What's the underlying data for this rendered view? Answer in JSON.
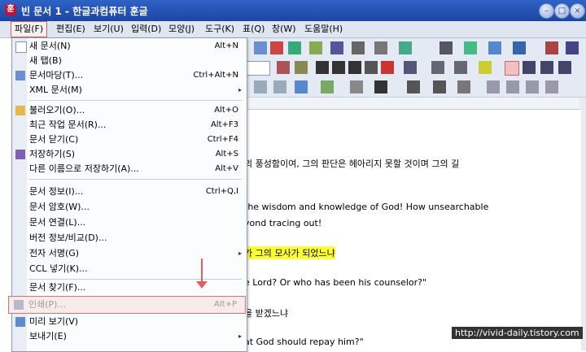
{
  "window": {
    "title": "빈 문서 1 - 한글과컴퓨터 훈글",
    "app_icon": "훈"
  },
  "menubar": [
    "파일(F)",
    "편집(E)",
    "보기(U)",
    "입력(D)",
    "모양(J)",
    "도구(K)",
    "표(Q)",
    "창(W)",
    "도움말(H)"
  ],
  "file_menu": [
    {
      "label": "새 문서(N)",
      "shortcut": "Alt+N",
      "icon": "new-document-icon"
    },
    {
      "label": "새 탭(B)",
      "shortcut": "",
      "icon": ""
    },
    {
      "label": "문서마당(T)...",
      "shortcut": "Ctrl+Alt+N",
      "icon": "template-icon"
    },
    {
      "label": "XML 문서(M)",
      "shortcut": "",
      "icon": "",
      "submenu": true
    },
    {
      "label": "불러오기(O)...",
      "shortcut": "Alt+O",
      "icon": "open-folder-icon"
    },
    {
      "label": "최근 작업 문서(R)...",
      "shortcut": "Alt+F3",
      "icon": ""
    },
    {
      "label": "문서 닫기(C)",
      "shortcut": "Ctrl+F4",
      "icon": ""
    },
    {
      "label": "저장하기(S)",
      "shortcut": "Alt+S",
      "icon": "save-icon"
    },
    {
      "label": "다른 이름으로 저장하기(A)...",
      "shortcut": "Alt+V",
      "icon": ""
    },
    {
      "label": "문서 정보(I)...",
      "shortcut": "Ctrl+Q,I",
      "icon": ""
    },
    {
      "label": "문서 암호(W)...",
      "shortcut": "",
      "icon": ""
    },
    {
      "label": "문서 연결(L)...",
      "shortcut": "",
      "icon": ""
    },
    {
      "label": "버전 정보/비교(D)...",
      "shortcut": "",
      "icon": ""
    },
    {
      "label": "전자 서명(G)",
      "shortcut": "",
      "icon": "",
      "submenu": true
    },
    {
      "label": "CCL 넣기(K)...",
      "shortcut": "",
      "icon": ""
    },
    {
      "label": "문서 찾기(F)...",
      "shortcut": "",
      "icon": ""
    },
    {
      "label": "인쇄(P)...",
      "shortcut": "Alt+P",
      "icon": "print-icon",
      "disabled": true
    },
    {
      "label": "미리 보기(V)",
      "shortcut": "",
      "icon": "preview-icon"
    },
    {
      "label": "보내기(E)",
      "shortcut": "",
      "icon": "",
      "submenu": true
    }
  ],
  "document": {
    "lines": [
      "의 풍성함이여, 그의 판단은 헤아리지 못할 것이며 그의 길",
      "the wisdom and knowledge of God! How unsearchable",
      "yond tracing out!",
      "가 그의 모사가 되었느냐",
      "e Lord? Or who has been his counselor?\"",
      "을 받겠느냐",
      "at God should repay him?\""
    ]
  },
  "watermark": "http://vivid-daily.tistory.com"
}
